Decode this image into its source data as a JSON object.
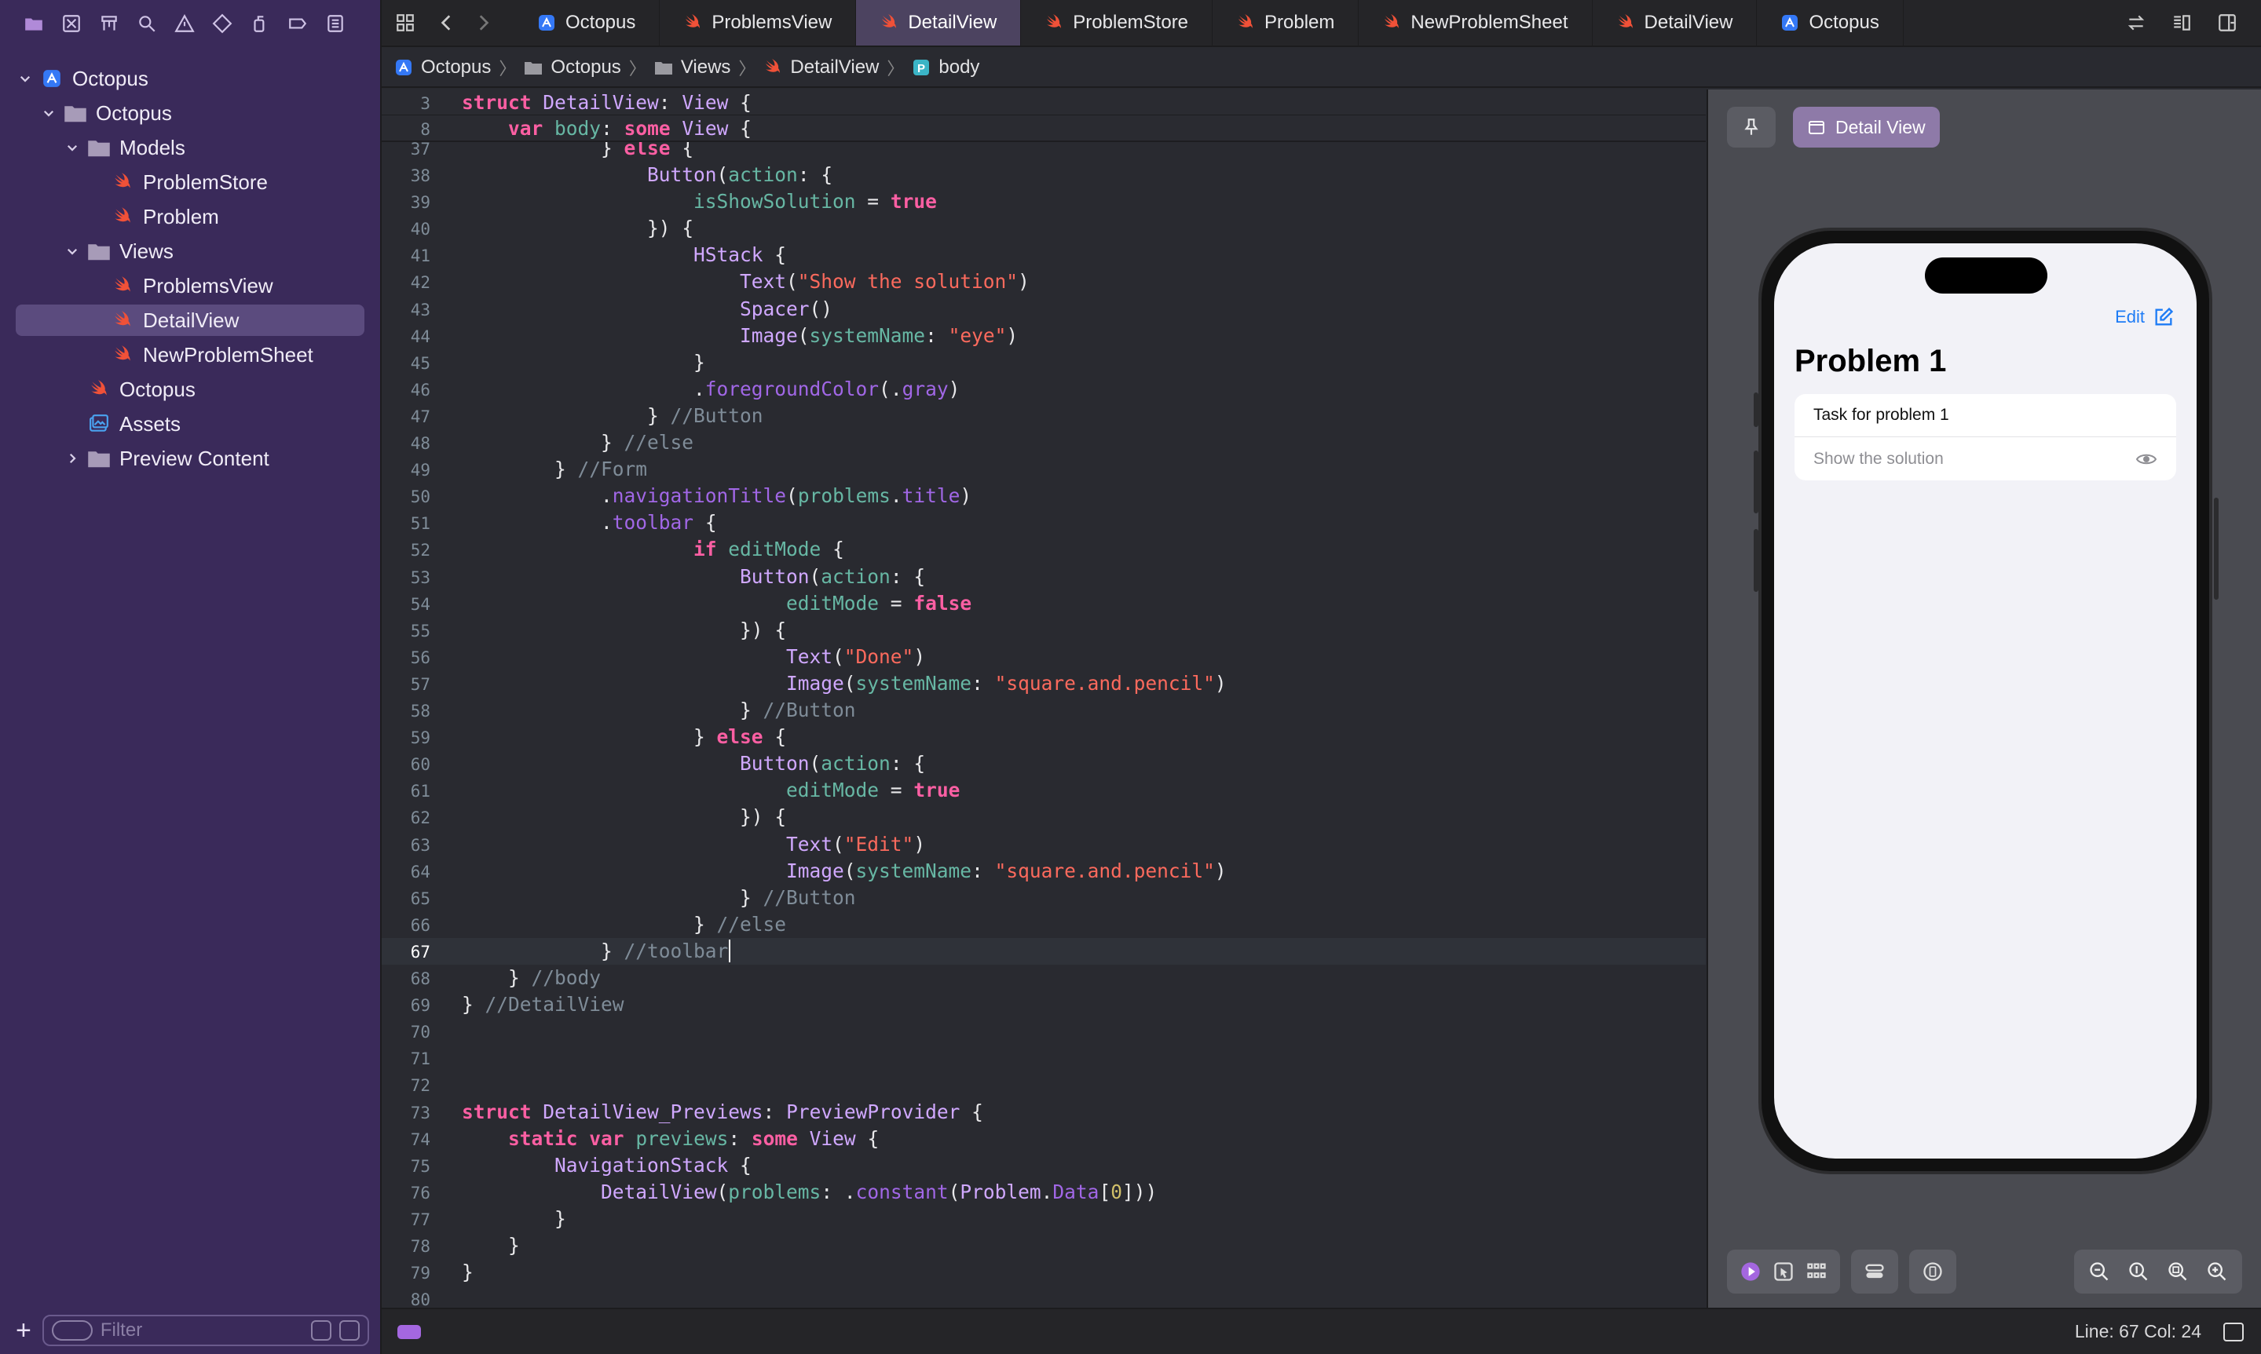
{
  "sidebar": {
    "project": "Octopus",
    "items": [
      {
        "label": "Octopus",
        "icon": "app-project-icon",
        "level": 0,
        "expanded": true
      },
      {
        "label": "Octopus",
        "icon": "folder-icon",
        "level": 1,
        "expanded": true
      },
      {
        "label": "Models",
        "icon": "folder-icon",
        "level": 2,
        "expanded": true
      },
      {
        "label": "ProblemStore",
        "icon": "swift-file-icon",
        "level": 3
      },
      {
        "label": "Problem",
        "icon": "swift-file-icon",
        "level": 3
      },
      {
        "label": "Views",
        "icon": "folder-icon",
        "level": 2,
        "expanded": true
      },
      {
        "label": "ProblemsView",
        "icon": "swift-file-icon",
        "level": 3
      },
      {
        "label": "DetailView",
        "icon": "swift-file-icon",
        "level": 3,
        "selected": true
      },
      {
        "label": "NewProblemSheet",
        "icon": "swift-file-icon",
        "level": 3
      },
      {
        "label": "Octopus",
        "icon": "swift-file-icon",
        "level": 2
      },
      {
        "label": "Assets",
        "icon": "asset-catalog-icon",
        "level": 2
      },
      {
        "label": "Preview Content",
        "icon": "folder-icon",
        "level": 2,
        "expanded": false
      }
    ],
    "filter_placeholder": "Filter"
  },
  "tabs": [
    {
      "label": "Octopus",
      "icon": "project-icon"
    },
    {
      "label": "ProblemsView",
      "icon": "swift-icon"
    },
    {
      "label": "DetailView",
      "icon": "swift-icon",
      "active": true
    },
    {
      "label": "ProblemStore",
      "icon": "swift-icon"
    },
    {
      "label": "Problem",
      "icon": "swift-icon"
    },
    {
      "label": "NewProblemSheet",
      "icon": "swift-icon"
    },
    {
      "label": "DetailView",
      "icon": "swift-icon"
    },
    {
      "label": "Octopus",
      "icon": "project-icon"
    }
  ],
  "breadcrumb": [
    "Octopus",
    "Octopus",
    "Views",
    "DetailView",
    "body"
  ],
  "editor": {
    "sticky": [
      {
        "n": "3",
        "code": "struct DetailView: View {"
      },
      {
        "n": "8",
        "code": "    var body: some View {"
      }
    ],
    "partial_line": {
      "n": "37",
      "code": "            } else {"
    },
    "current_line": "67",
    "lines": [
      {
        "n": "38",
        "code": "                Button(action: {"
      },
      {
        "n": "39",
        "code": "                    isShowSolution = true"
      },
      {
        "n": "40",
        "code": "                }) {"
      },
      {
        "n": "41",
        "code": "                    HStack {"
      },
      {
        "n": "42",
        "code": "                        Text(\"Show the solution\")"
      },
      {
        "n": "43",
        "code": "                        Spacer()"
      },
      {
        "n": "44",
        "code": "                        Image(systemName: \"eye\")"
      },
      {
        "n": "45",
        "code": "                    }"
      },
      {
        "n": "46",
        "code": "                    .foregroundColor(.gray)"
      },
      {
        "n": "47",
        "code": "                } //Button"
      },
      {
        "n": "48",
        "code": "            } //else"
      },
      {
        "n": "49",
        "code": "        } //Form"
      },
      {
        "n": "50",
        "code": "            .navigationTitle(problems.title)"
      },
      {
        "n": "51",
        "code": "            .toolbar {"
      },
      {
        "n": "52",
        "code": "                    if editMode {"
      },
      {
        "n": "53",
        "code": "                        Button(action: {"
      },
      {
        "n": "54",
        "code": "                            editMode = false"
      },
      {
        "n": "55",
        "code": "                        }) {"
      },
      {
        "n": "56",
        "code": "                            Text(\"Done\")"
      },
      {
        "n": "57",
        "code": "                            Image(systemName: \"square.and.pencil\")"
      },
      {
        "n": "58",
        "code": "                        } //Button"
      },
      {
        "n": "59",
        "code": "                    } else {"
      },
      {
        "n": "60",
        "code": "                        Button(action: {"
      },
      {
        "n": "61",
        "code": "                            editMode = true"
      },
      {
        "n": "62",
        "code": "                        }) {"
      },
      {
        "n": "63",
        "code": "                            Text(\"Edit\")"
      },
      {
        "n": "64",
        "code": "                            Image(systemName: \"square.and.pencil\")"
      },
      {
        "n": "65",
        "code": "                        } //Button"
      },
      {
        "n": "66",
        "code": "                    } //else"
      },
      {
        "n": "67",
        "code": "            } //toolbar"
      },
      {
        "n": "68",
        "code": "    } //body"
      },
      {
        "n": "69",
        "code": "} //DetailView"
      },
      {
        "n": "70",
        "code": ""
      },
      {
        "n": "71",
        "code": ""
      },
      {
        "n": "72",
        "code": ""
      },
      {
        "n": "73",
        "code": "struct DetailView_Previews: PreviewProvider {"
      },
      {
        "n": "74",
        "code": "    static var previews: some View {"
      },
      {
        "n": "75",
        "code": "        NavigationStack {"
      },
      {
        "n": "76",
        "code": "            DetailView(problems: .constant(Problem.Data[0]))"
      },
      {
        "n": "77",
        "code": "        }"
      },
      {
        "n": "78",
        "code": "    }"
      },
      {
        "n": "79",
        "code": "}"
      },
      {
        "n": "80",
        "code": ""
      }
    ]
  },
  "preview": {
    "chip_label": "Detail View",
    "nav_edit": "Edit",
    "title": "Problem 1",
    "row_task": "Task for problem 1",
    "row_solution": "Show the solution"
  },
  "status": {
    "position": "Line: 67  Col: 24"
  },
  "colors": {
    "sidebar_bg": "#3a2a5a",
    "editor_bg": "#292a30",
    "keyword": "#fc5fa3",
    "string": "#fc6a5d",
    "accent": "#a467e0"
  }
}
